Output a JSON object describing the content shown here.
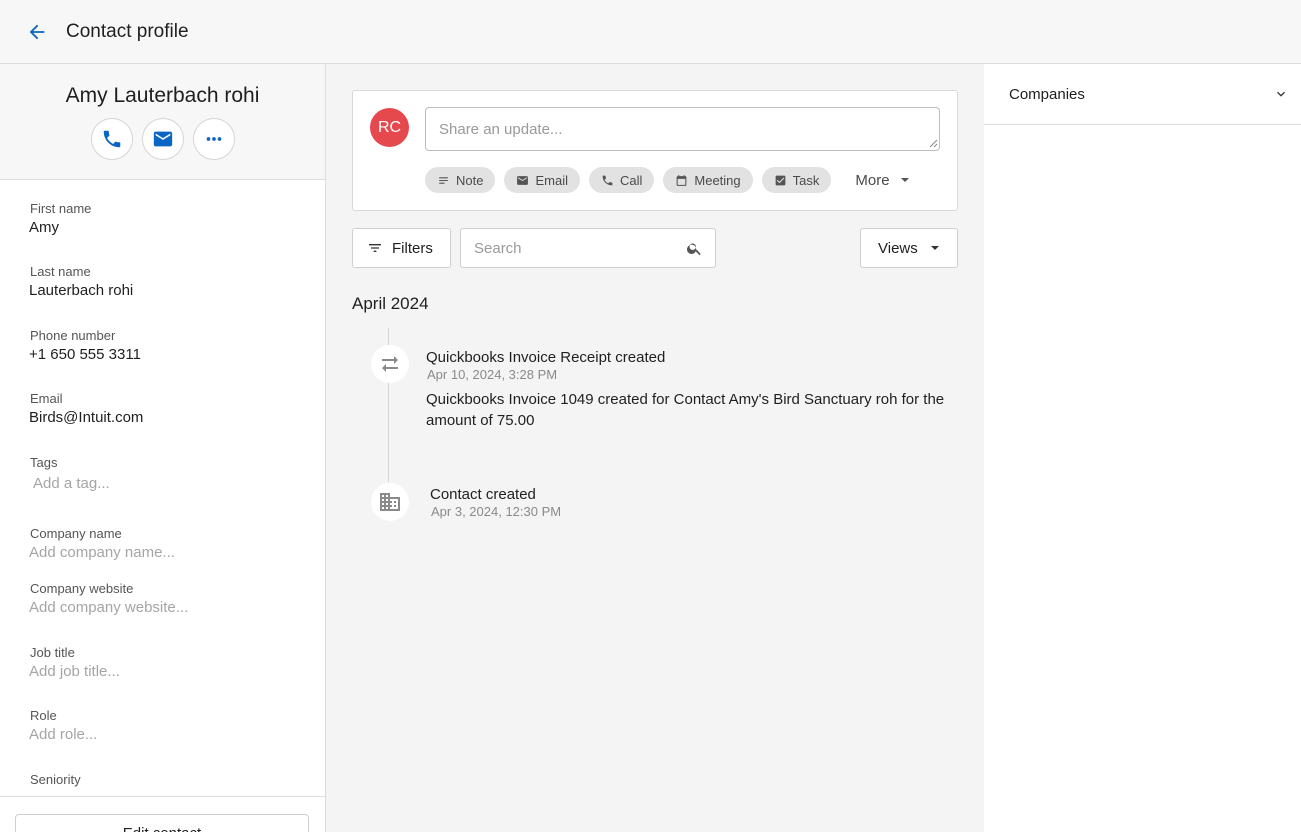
{
  "header": {
    "title": "Contact profile"
  },
  "contact": {
    "name": "Amy Lauterbach rohi",
    "fields": [
      {
        "label": "First name",
        "value": "Amy",
        "placeholder": false
      },
      {
        "label": "Last name",
        "value": "Lauterbach rohi",
        "placeholder": false
      },
      {
        "label": "Phone number",
        "value": "+1 650 555 3311",
        "placeholder": false
      },
      {
        "label": "Email",
        "value": "Birds@Intuit.com",
        "placeholder": false
      },
      {
        "label": "Tags",
        "value": "Add a tag...",
        "placeholder": true
      },
      {
        "label": "Company name",
        "value": "Add company name...",
        "placeholder": true
      },
      {
        "label": "Company website",
        "value": "Add company website...",
        "placeholder": true
      },
      {
        "label": "Job title",
        "value": "Add job title...",
        "placeholder": true
      },
      {
        "label": "Role",
        "value": "Add role...",
        "placeholder": true
      },
      {
        "label": "Seniority",
        "value": "",
        "placeholder": true
      }
    ],
    "edit_label": "Edit contact"
  },
  "composer": {
    "avatar_initials": "RC",
    "avatar_color": "#e5484d",
    "placeholder": "Share an update...",
    "chips": [
      {
        "label": "Note",
        "icon": "note-icon"
      },
      {
        "label": "Email",
        "icon": "email-icon"
      },
      {
        "label": "Call",
        "icon": "phone-icon"
      },
      {
        "label": "Meeting",
        "icon": "calendar-icon"
      },
      {
        "label": "Task",
        "icon": "task-icon"
      }
    ],
    "more_label": "More"
  },
  "toolbar": {
    "filters_label": "Filters",
    "search_placeholder": "Search",
    "views_label": "Views"
  },
  "timeline": {
    "month": "April 2024",
    "events": [
      {
        "icon": "sync-arrows-icon",
        "title": "Quickbooks Invoice Receipt created",
        "time": "Apr 10, 2024, 3:28 PM",
        "body": "Quickbooks Invoice 1049 created for Contact Amy's Bird Sanctuary roh for the amount of 75.00"
      },
      {
        "icon": "building-icon",
        "title": "Contact created",
        "time": "Apr 3, 2024, 12:30 PM",
        "body": ""
      }
    ]
  },
  "sidebar_right": {
    "companies_label": "Companies"
  },
  "colors": {
    "accent": "#0b66c3"
  }
}
